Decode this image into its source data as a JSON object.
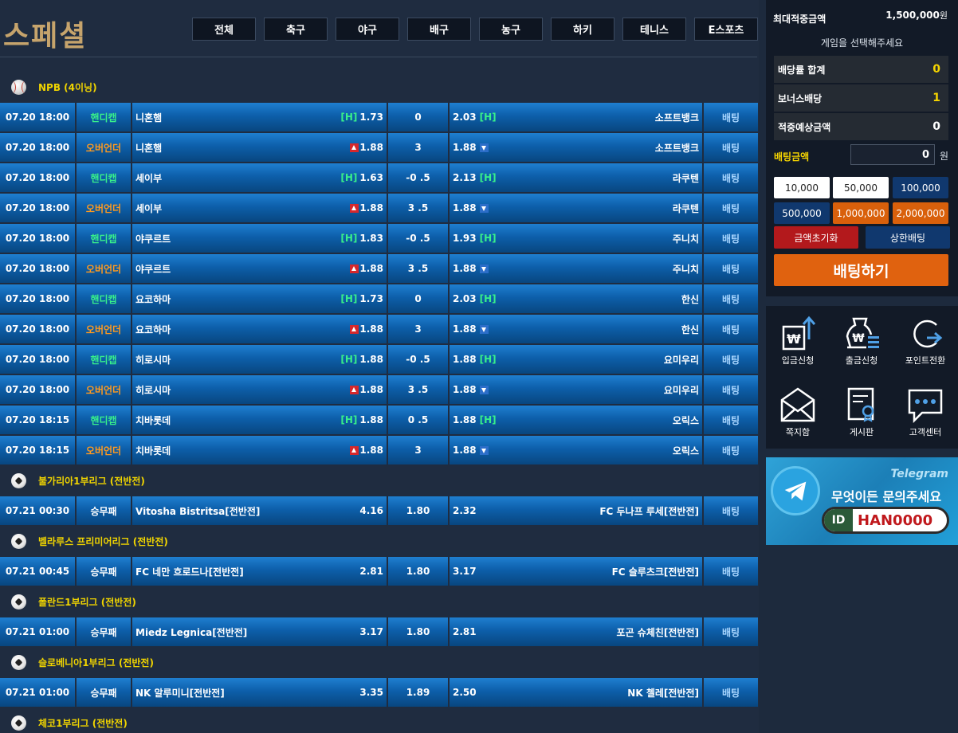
{
  "header": {
    "title": "스페셜",
    "tabs": [
      "전체",
      "축구",
      "야구",
      "배구",
      "농구",
      "하키",
      "테니스",
      "E스포츠"
    ]
  },
  "leagues": [
    {
      "name": "NPB (4이닝)",
      "icon": "baseball-icon",
      "rows": [
        {
          "time": "07.20 18:00",
          "type": "핸디캡",
          "kind": "h",
          "home": "니혼햄",
          "home_odds": "1.73",
          "mid": "0",
          "away_odds": "2.03",
          "away": "소프트뱅크"
        },
        {
          "time": "07.20 18:00",
          "type": "오버언더",
          "kind": "o",
          "home": "니혼햄",
          "home_odds": "1.88",
          "mid": "3",
          "away_odds": "1.88",
          "away": "소프트뱅크"
        },
        {
          "time": "07.20 18:00",
          "type": "핸디캡",
          "kind": "h",
          "home": "세이부",
          "home_odds": "1.63",
          "mid": "-0 .5",
          "away_odds": "2.13",
          "away": "라쿠텐"
        },
        {
          "time": "07.20 18:00",
          "type": "오버언더",
          "kind": "o",
          "home": "세이부",
          "home_odds": "1.88",
          "mid": "3 .5",
          "away_odds": "1.88",
          "away": "라쿠텐"
        },
        {
          "time": "07.20 18:00",
          "type": "핸디캡",
          "kind": "h",
          "home": "야쿠르트",
          "home_odds": "1.83",
          "mid": "-0 .5",
          "away_odds": "1.93",
          "away": "주니치"
        },
        {
          "time": "07.20 18:00",
          "type": "오버언더",
          "kind": "o",
          "home": "야쿠르트",
          "home_odds": "1.88",
          "mid": "3 .5",
          "away_odds": "1.88",
          "away": "주니치"
        },
        {
          "time": "07.20 18:00",
          "type": "핸디캡",
          "kind": "h",
          "home": "요코하마",
          "home_odds": "1.73",
          "mid": "0",
          "away_odds": "2.03",
          "away": "한신"
        },
        {
          "time": "07.20 18:00",
          "type": "오버언더",
          "kind": "o",
          "home": "요코하마",
          "home_odds": "1.88",
          "mid": "3",
          "away_odds": "1.88",
          "away": "한신"
        },
        {
          "time": "07.20 18:00",
          "type": "핸디캡",
          "kind": "h",
          "home": "히로시마",
          "home_odds": "1.88",
          "mid": "-0 .5",
          "away_odds": "1.88",
          "away": "요미우리"
        },
        {
          "time": "07.20 18:00",
          "type": "오버언더",
          "kind": "o",
          "home": "히로시마",
          "home_odds": "1.88",
          "mid": "3 .5",
          "away_odds": "1.88",
          "away": "요미우리"
        },
        {
          "time": "07.20 18:15",
          "type": "핸디캡",
          "kind": "h",
          "home": "치바롯데",
          "home_odds": "1.88",
          "mid": "0 .5",
          "away_odds": "1.88",
          "away": "오릭스"
        },
        {
          "time": "07.20 18:15",
          "type": "오버언더",
          "kind": "o",
          "home": "치바롯데",
          "home_odds": "1.88",
          "mid": "3",
          "away_odds": "1.88",
          "away": "오릭스"
        }
      ]
    },
    {
      "name": "불가리아1부리그 (전반전)",
      "icon": "soccer-ball-icon",
      "rows": [
        {
          "time": "07.21 00:30",
          "type": "승무패",
          "kind": "w",
          "home": "Vitosha Bistritsa[전반전]",
          "home_odds": "4.16",
          "mid": "1.80",
          "away_odds": "2.32",
          "away": "FC 두나프 루세[전반전]"
        }
      ]
    },
    {
      "name": "벨라루스 프리미어리그 (전반전)",
      "icon": "soccer-ball-icon",
      "rows": [
        {
          "time": "07.21 00:45",
          "type": "승무패",
          "kind": "w",
          "home": "FC 네만 흐로드나[전반전]",
          "home_odds": "2.81",
          "mid": "1.80",
          "away_odds": "3.17",
          "away": "FC 슬루츠크[전반전]"
        }
      ]
    },
    {
      "name": "폴란드1부리그 (전반전)",
      "icon": "soccer-ball-icon",
      "rows": [
        {
          "time": "07.21 01:00",
          "type": "승무패",
          "kind": "w",
          "home": "Miedz Legnica[전반전]",
          "home_odds": "3.17",
          "mid": "1.80",
          "away_odds": "2.81",
          "away": "포곤 슈체친[전반전]"
        }
      ]
    },
    {
      "name": "슬로베니아1부리그 (전반전)",
      "icon": "soccer-ball-icon",
      "rows": [
        {
          "time": "07.21 01:00",
          "type": "승무패",
          "kind": "w",
          "home": "NK 알루미니[전반전]",
          "home_odds": "3.35",
          "mid": "1.89",
          "away_odds": "2.50",
          "away": "NK 첼레[전반전]"
        }
      ]
    },
    {
      "name": "체코1부리그 (전반전)",
      "icon": "soccer-ball-icon",
      "rows": []
    }
  ],
  "labels": {
    "handicap_mark": "[H]",
    "bet": "배팅"
  },
  "slip": {
    "max_label": "최대적중금액",
    "max_value": "1,500,000",
    "max_unit": "원",
    "choose_game": "게임을 선택해주세요",
    "odds_sum_label": "배당률 합계",
    "odds_sum_value": "0",
    "bonus_label": "보너스배당",
    "bonus_value": "1",
    "expected_label": "적중예상금액",
    "expected_value": "0",
    "bet_amount_label": "배팅금액",
    "bet_amount_value": "0",
    "bet_amount_unit": "원",
    "amounts": [
      "10,000",
      "50,000",
      "100,000",
      "500,000",
      "1,000,000",
      "2,000,000"
    ],
    "reset": "금액초기화",
    "max_bet": "상한배팅",
    "submit": "배팅하기"
  },
  "menu": [
    "입금신청",
    "출금신청",
    "포인트전환",
    "쪽지함",
    "게시판",
    "고객센터"
  ],
  "banner": {
    "brand": "Telegram",
    "message": "무엇이든 문의주세요",
    "id_tag": "ID",
    "id_value": "HAN0000"
  },
  "colors": {
    "accent_gold": "#c6a46c",
    "league_yellow": "#f0d400",
    "handicap_green": "#38f08a",
    "overunder_orange": "#ff9a1f",
    "row_blue": "#0d5faa",
    "bet_orange": "#e0620f"
  }
}
